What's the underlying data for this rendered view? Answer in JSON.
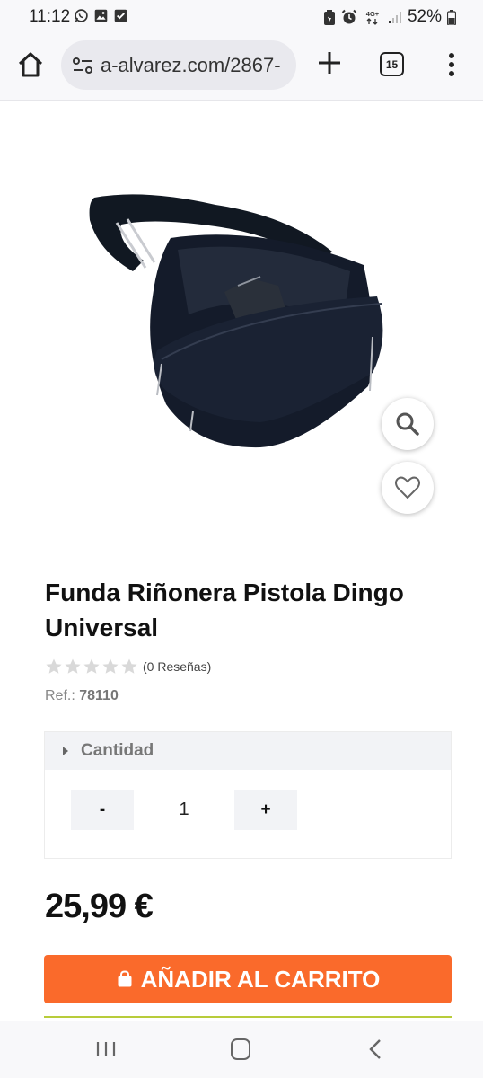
{
  "status_bar": {
    "time": "11:12",
    "battery": "52%",
    "network": "4G+",
    "left_icons": [
      "whatsapp-icon",
      "gallery-icon",
      "check-icon"
    ],
    "right_icons": [
      "battery-saver-icon",
      "alarm-icon",
      "network-4g-icon",
      "signal-icon",
      "battery-icon"
    ]
  },
  "browser": {
    "url": "a-alvarez.com/2867-",
    "tab_count": "15"
  },
  "product": {
    "title": "Funda Riñonera Pistola Dingo Universal",
    "reviews": "(0 Reseñas)",
    "rating": 0,
    "rating_max": 5,
    "ref_label": "Ref.:",
    "ref_value": "78110",
    "quantity_label": "Cantidad",
    "minus_label": "-",
    "quantity": "1",
    "plus_label": "+",
    "price": "25,99 €",
    "add_to_cart": "AÑADIR AL CARRITO"
  },
  "colors": {
    "accent": "#fa6a2b",
    "accent_line": "#b8cc3a",
    "star_empty": "#d9d9d9"
  }
}
